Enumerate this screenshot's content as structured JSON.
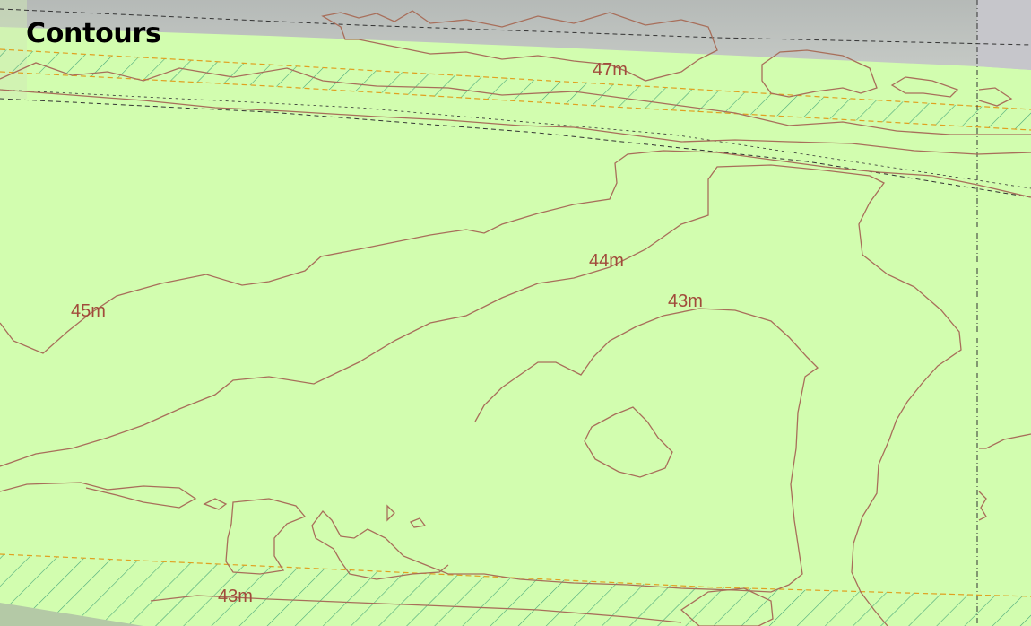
{
  "panel": {
    "title": "Contours"
  },
  "colors": {
    "land": "#d2fdaf",
    "contour": "#a86e5a",
    "contour_label": "#a14b3b",
    "road_band": "#b9b9bf",
    "boundary_dashed": "#e0a020",
    "hatch": "#4aa97a"
  },
  "contour_labels": [
    {
      "id": "label-47m-top",
      "text": "47m"
    },
    {
      "id": "label-44m",
      "text": "44m"
    },
    {
      "id": "label-45m",
      "text": "45m"
    },
    {
      "id": "label-43m-centre",
      "text": "43m"
    },
    {
      "id": "label-43m-bottom",
      "text": "43m"
    }
  ]
}
